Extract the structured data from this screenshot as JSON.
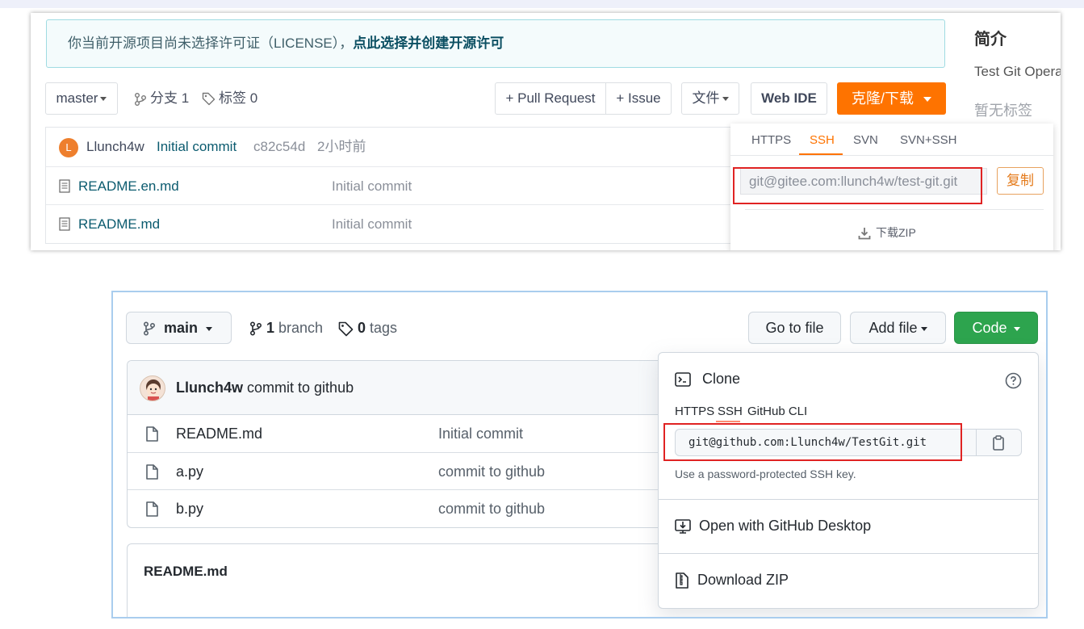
{
  "gitee": {
    "notice": {
      "text": "你当前开源项目尚未选择许可证（LICENSE），",
      "link": "点此选择并创建开源许可"
    },
    "branch_select": "master",
    "branches": "分支 1",
    "tags": "标签 0",
    "pull_request": "+ Pull Request",
    "issue": "+ Issue",
    "file_menu": "文件",
    "web_ide": "Web IDE",
    "clone_button": "克隆/下载",
    "commit": {
      "avatar_letter": "L",
      "author": "Llunch4w",
      "message": "Initial commit",
      "hash": "c82c54d",
      "time": "2小时前"
    },
    "files": [
      {
        "name": "README.en.md",
        "message": "Initial commit"
      },
      {
        "name": "README.md",
        "message": "Initial commit"
      }
    ],
    "sidebar": {
      "title": "简介",
      "description": "Test Git Opera",
      "tags_empty": "暂无标签"
    },
    "dropdown": {
      "tabs": [
        "HTTPS",
        "SSH",
        "SVN",
        "SVN+SSH"
      ],
      "active_tab": "SSH",
      "url": "git@gitee.com:llunch4w/test-git.git",
      "copy": "复制",
      "download_zip": "下载ZIP"
    },
    "colors": {
      "accent": "#fe7300",
      "link": "#0b5b6f",
      "highlight": "#e02323"
    }
  },
  "github": {
    "branch_select": "main",
    "branch_count": "1",
    "branch_label": "branch",
    "tag_count": "0",
    "tag_label": "tags",
    "go_to_file": "Go to file",
    "add_file": "Add file",
    "code": "Code",
    "commit": {
      "author": "Llunch4w",
      "message": "commit to github"
    },
    "files": [
      {
        "name": "README.md",
        "message": "Initial commit"
      },
      {
        "name": "a.py",
        "message": "commit to github"
      },
      {
        "name": "b.py",
        "message": "commit to github"
      }
    ],
    "readme_title": "README.md",
    "dropdown": {
      "title": "Clone",
      "tabs": [
        "HTTPS",
        "SSH",
        "GitHub CLI"
      ],
      "active_tab": "SSH",
      "url": "git@github.com:Llunch4w/TestGit.git",
      "hint": "Use a password-protected SSH key.",
      "open_desktop": "Open with GitHub Desktop",
      "download_zip": "Download ZIP"
    },
    "colors": {
      "code_button": "#2da44e",
      "active_tab_underline": "#fd8c73",
      "highlight": "#e02323"
    }
  }
}
